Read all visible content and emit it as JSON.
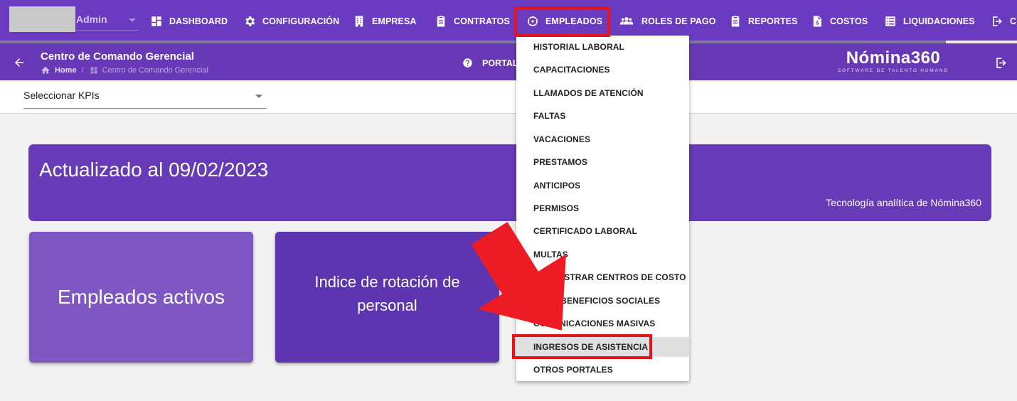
{
  "topnav": {
    "user_name": "Admin",
    "items": [
      {
        "label": "DASHBOARD",
        "icon": "dashboard-icon"
      },
      {
        "label": "CONFIGURACIÓN",
        "icon": "gear-icon"
      },
      {
        "label": "EMPRESA",
        "icon": "building-icon"
      },
      {
        "label": "CONTRATOS",
        "icon": "clipboard-icon"
      },
      {
        "label": "EMPLEADOS",
        "icon": "support-icon"
      },
      {
        "label": "ROLES DE PAGO",
        "icon": "users-icon"
      },
      {
        "label": "REPORTES",
        "icon": "clipboard-icon"
      },
      {
        "label": "COSTOS",
        "icon": "invoice-icon"
      },
      {
        "label": "LIQUIDACIONES",
        "icon": "list-icon"
      },
      {
        "label": "C",
        "icon": "sign-out-icon"
      }
    ]
  },
  "subheader": {
    "title": "Centro de Comando Gerencial",
    "breadcrumb_home": "Home",
    "breadcrumb_sep": "/",
    "breadcrumb_current": "Centro de Comando Gerencial",
    "portal_label": "PORTAL",
    "logo_main": "Nómina360",
    "logo_sub": "SOFTWARE DE TALENTO HUMANO"
  },
  "kpi": {
    "label": "Seleccionar KPIs"
  },
  "banner": {
    "title": "Actualizado al 09/02/2023",
    "subtitle": "Tecnología analítica de Nómina360"
  },
  "cards": [
    {
      "label": "Empleados activos"
    },
    {
      "line1": "Indice de rotación de",
      "line2": "personal"
    }
  ],
  "dropdown": {
    "items": [
      "HISTORIAL LABORAL",
      "CAPACITACIONES",
      "LLAMADOS DE ATENCIÓN",
      "FALTAS",
      "VACACIONES",
      "PRESTAMOS",
      "ANTICIPOS",
      "PERMISOS",
      "CERTIFICADO LABORAL",
      "MULTAS",
      "ADMINISTRAR CENTROS DE COSTO",
      "PAGO BENEFICIOS SOCIALES",
      "COMUNICACIONES MASIVAS",
      "INGRESOS DE ASISTENCIA",
      "OTROS PORTALES"
    ],
    "active_index": 13
  },
  "colors": {
    "nav_bg": "#6a3bc0",
    "subheader_bg": "#6839b6",
    "banner_bg": "#673ab7",
    "card_1_bg": "#7e57c2",
    "card_2_bg": "#5e35b1",
    "highlight_red": "#e3151c"
  }
}
